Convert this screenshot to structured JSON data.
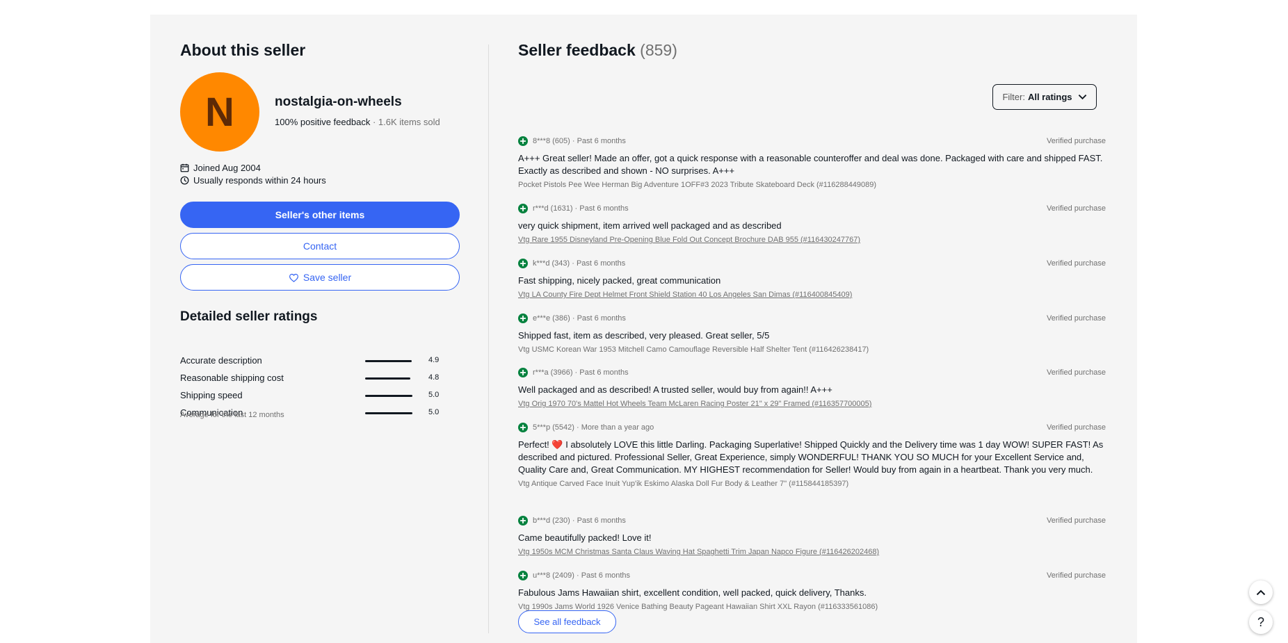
{
  "about": {
    "title": "About this seller",
    "avatar_letter": "N",
    "avatar_color": "#ff8800",
    "seller_name": "nostalgia-on-wheels",
    "positive_feedback": "100% positive feedback",
    "items_sold": "· 1.6K items sold",
    "joined": "Joined Aug 2004",
    "responds": "Usually responds within 24 hours",
    "btn_other_items": "Seller's other items",
    "btn_contact": "Contact",
    "btn_save": "Save seller"
  },
  "ratings": {
    "title": "Detailed seller ratings",
    "items": [
      {
        "label": "Accurate description",
        "value": "4.9"
      },
      {
        "label": "Reasonable shipping cost",
        "value": "4.8"
      },
      {
        "label": "Shipping speed",
        "value": "5.0"
      },
      {
        "label": "Communication",
        "value": "5.0"
      }
    ],
    "note": "Average for the last 12 months"
  },
  "feedback": {
    "title": "Seller feedback",
    "count": "(859)",
    "filter_label": "Filter:",
    "filter_value": "All ratings",
    "verified_label": "Verified purchase",
    "see_all": "See all feedback",
    "items": [
      {
        "user": "8***8 (605) · Past 6 months",
        "text": "A+++ Great seller! Made an offer, got a quick response with a reasonable counteroffer and deal was done. Packaged with care and shipped FAST. Exactly as described and shown - NO surprises. A+++",
        "product": "Pocket Pistols Pee Wee Herman Big Adventure 1OFF#3 2023 Tribute Skateboard Deck (#116288449089)",
        "link": false
      },
      {
        "user": "r***d (1631) · Past 6 months",
        "text": "very quick shipment, item arrived well packaged and as described",
        "product": "Vtg Rare 1955 Disneyland Pre-Opening Blue Fold Out Concept Brochure DAB 955 (#116430247767)",
        "link": true
      },
      {
        "user": "k***d (343) · Past 6 months",
        "text": "Fast shipping, nicely packed, great communication",
        "product": "Vtg LA County Fire Dept Helmet Front Shield Station 40 Los Angeles San Dimas (#116400845409)",
        "link": true
      },
      {
        "user": "e***e (386) · Past 6 months",
        "text": "Shipped fast, item as described, very pleased. Great seller, 5/5",
        "product": "Vtg USMC Korean War 1953 Mitchell Camo Camouflage Reversible Half Shelter Tent (#116426238417)",
        "link": false
      },
      {
        "user": "r***a (3966) · Past 6 months",
        "text": "Well packaged and as described! A trusted seller, would buy from again!! A+++",
        "product": "Vtg Orig 1970 70's Mattel Hot Wheels Team McLaren Racing Poster 21\" x 29\" Framed (#116357700005)",
        "link": true
      },
      {
        "user": "5***p (5542) · More than a year ago",
        "text": "Perfect! ❤️ I absolutely LOVE this little Darling. Packaging Superlative! Shipped Quickly and the Delivery time was 1 day WOW! SUPER FAST! As described and pictured. Professional Seller, Great Experience, simply WONDERFUL! THANK YOU SO MUCH for your Excellent Service and, Quality Care and, Great Communication. MY HIGHEST recommendation for Seller! Would buy from again in a heartbeat. Thank you very much.",
        "product": "Vtg Antique Carved Face Inuit Yup'ik Eskimo Alaska Doll Fur Body & Leather 7\" (#115844185397)",
        "link": false
      },
      {
        "user": "b***d (230) · Past 6 months",
        "text": "Came beautifully packed! Love it!",
        "product": "Vtg 1950s MCM Christmas Santa Claus Waving Hat Spaghetti Trim Japan Napco Figure (#116426202468)",
        "link": true
      },
      {
        "user": "u***8 (2409) · Past 6 months",
        "text": "Fabulous Jams Hawaiian shirt, excellent condition, well packed, quick delivery, Thanks.",
        "product": "Vtg 1990s Jams World 1926 Venice Bathing Beauty Pageant Hawaiian Shirt XXL Rayon (#116333561086)",
        "link": false
      }
    ]
  },
  "colors": {
    "accent": "#3665f3",
    "positive": "#05823f",
    "panel_bg": "#f5f5f5"
  },
  "floating": {
    "help_label": "?"
  }
}
